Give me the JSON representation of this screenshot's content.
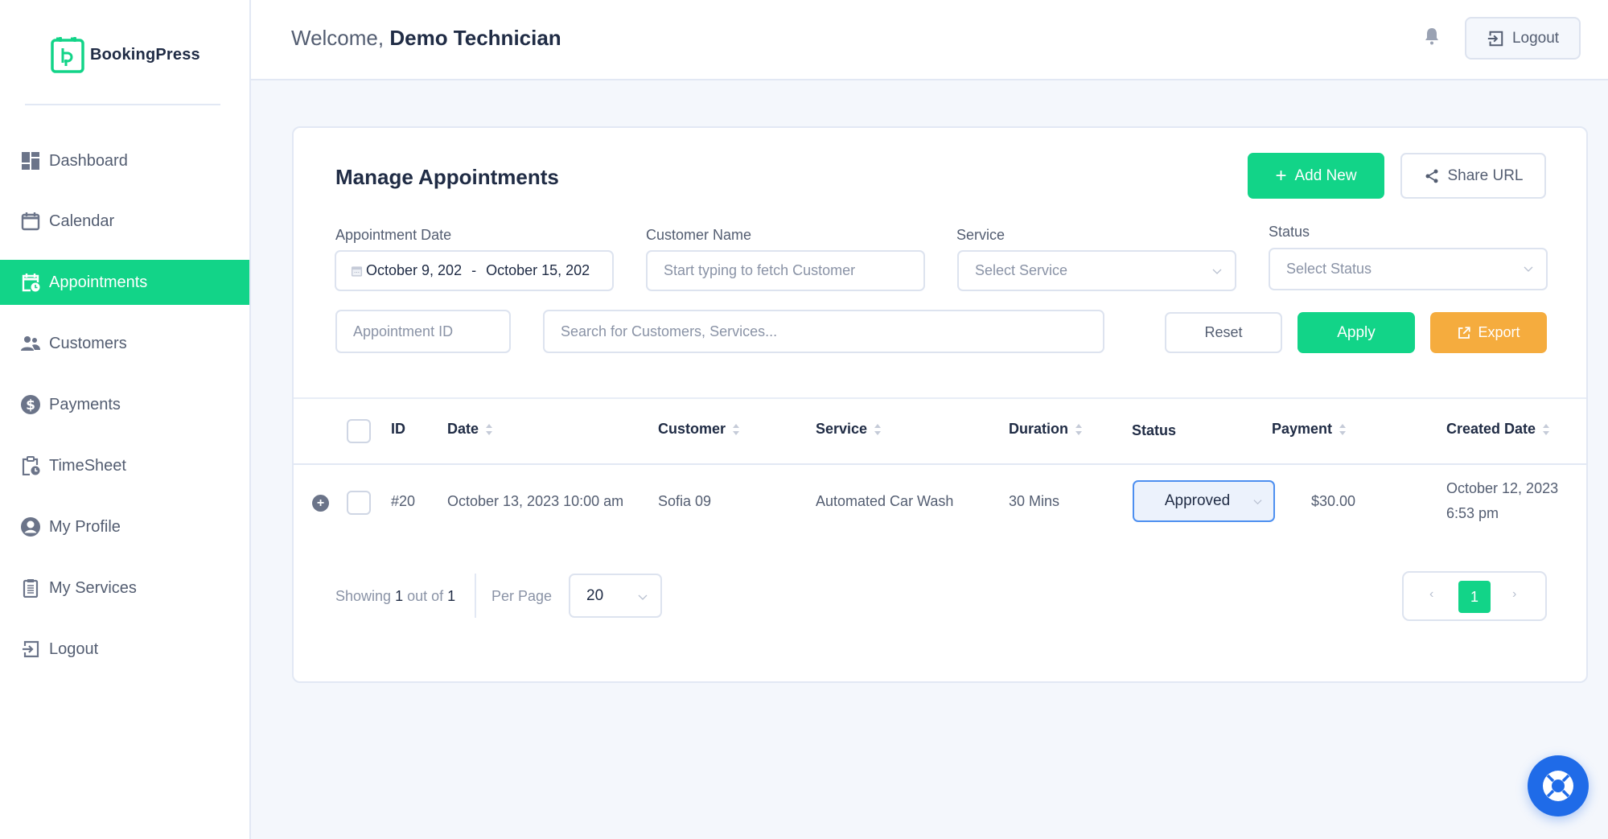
{
  "brand": {
    "name": "BookingPress",
    "accent": "#12d488"
  },
  "sidebar": {
    "items": [
      {
        "label": "Dashboard",
        "icon": "dashboard-icon"
      },
      {
        "label": "Calendar",
        "icon": "calendar-icon"
      },
      {
        "label": "Appointments",
        "icon": "appointments-icon",
        "active": true
      },
      {
        "label": "Customers",
        "icon": "customers-icon"
      },
      {
        "label": "Payments",
        "icon": "dollar-icon"
      },
      {
        "label": "TimeSheet",
        "icon": "timesheet-icon"
      },
      {
        "label": "My Profile",
        "icon": "user-icon"
      },
      {
        "label": "My Services",
        "icon": "clipboard-list-icon"
      },
      {
        "label": "Logout",
        "icon": "logout-icon"
      }
    ]
  },
  "header": {
    "welcome_prefix": "Welcome,",
    "user_name": "Demo Technician",
    "logout_label": "Logout"
  },
  "page": {
    "title": "Manage Appointments",
    "add_new_label": "Add New",
    "share_url_label": "Share URL"
  },
  "filters": {
    "appointment_date_label": "Appointment Date",
    "date_start": "October 9, 202",
    "date_sep": "-",
    "date_end": "October 15, 202",
    "customer_name_label": "Customer Name",
    "customer_placeholder": "Start typing to fetch Customer",
    "service_label": "Service",
    "service_placeholder": "Select Service",
    "status_label": "Status",
    "status_placeholder": "Select Status",
    "appointment_id_placeholder": "Appointment ID",
    "search_placeholder": "Search for Customers, Services...",
    "reset_label": "Reset",
    "apply_label": "Apply",
    "export_label": "Export"
  },
  "table": {
    "columns": [
      "ID",
      "Date",
      "Customer",
      "Service",
      "Duration",
      "Status",
      "Payment",
      "Created Date"
    ],
    "rows": [
      {
        "id": "#20",
        "date": "October 13, 2023 10:00 am",
        "customer": "Sofia 09",
        "service": "Automated Car Wash",
        "duration": "30 Mins",
        "status": "Approved",
        "payment": "$30.00",
        "created_date": "October 12, 2023",
        "created_time": "6:53 pm"
      }
    ]
  },
  "pagination": {
    "showing_prefix": "Showing",
    "showing_count": "1",
    "out_of": "out of",
    "total": "1",
    "per_page_label": "Per Page",
    "per_page_value": "20",
    "current_page": "1",
    "prev": "‹",
    "next": "›"
  }
}
